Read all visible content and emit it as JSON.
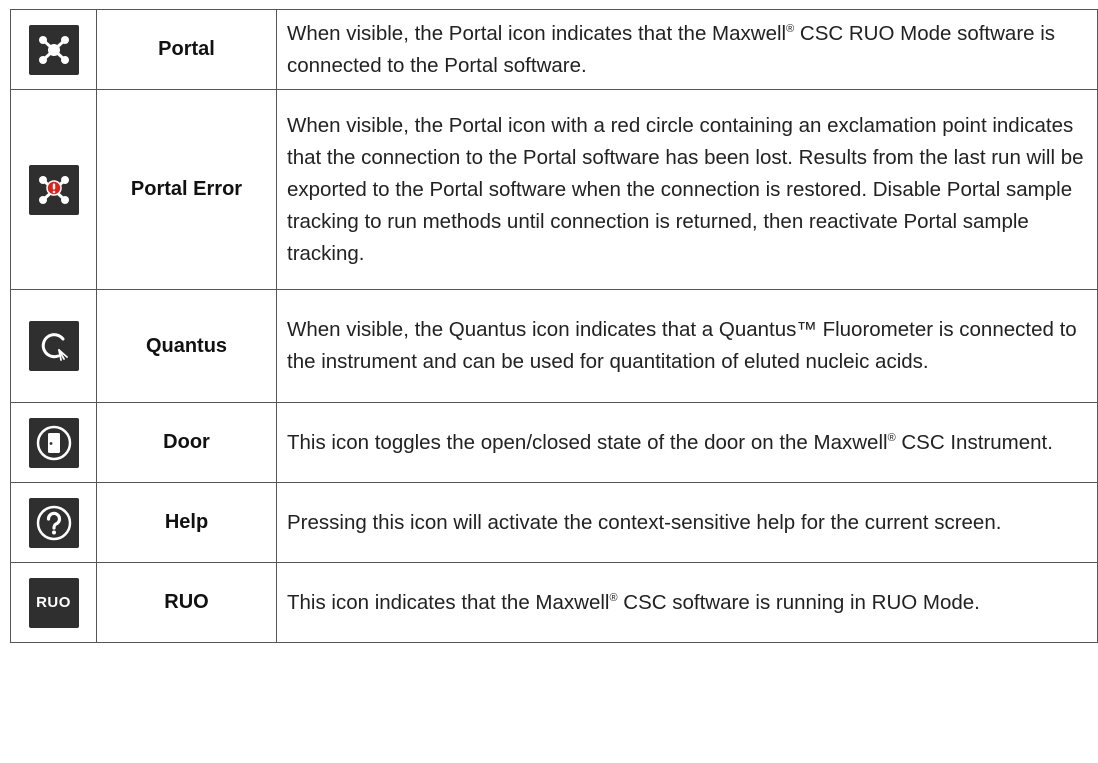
{
  "rows": [
    {
      "icon": "portal-icon",
      "name": "Portal",
      "desc_1": "When visible, the Portal icon indicates that the Maxwell",
      "desc_sup": "®",
      "desc_2": " CSC RUO Mode software is connected to the Portal software."
    },
    {
      "icon": "portal-error-icon",
      "name": "Portal Error",
      "desc_1": "When visible, the Portal icon with a red circle containing an exclamation point indicates that the connection to the Portal software has been lost. Results from the last run will be exported to the Portal software when the connection is restored. Disable Portal sample tracking to run methods until connection is returned, then reactivate Portal sample tracking."
    },
    {
      "icon": "quantus-icon",
      "name": "Quantus",
      "desc_1": "When visible, the Quantus icon indicates that a Quantus™ Fluorometer is connected to the instrument and can be used for quantitation of eluted nucleic acids."
    },
    {
      "icon": "door-icon",
      "name": "Door",
      "desc_1": "This icon toggles the open/closed state of the door on the Maxwell",
      "desc_sup": "®",
      "desc_2": " CSC Instrument."
    },
    {
      "icon": "help-icon",
      "name": "Help",
      "desc_1": "Pressing this icon will activate the context-sensitive help for the current screen."
    },
    {
      "icon": "ruo-icon",
      "icon_text": "RUO",
      "name": "RUO",
      "desc_1": "This icon indicates that the Maxwell",
      "desc_sup": "®",
      "desc_2": " CSC software is running in RUO Mode."
    }
  ],
  "colors": {
    "icon_background": "#2f2f2f",
    "icon_foreground": "#ffffff",
    "error_red": "#e0201b",
    "border": "#555555"
  }
}
